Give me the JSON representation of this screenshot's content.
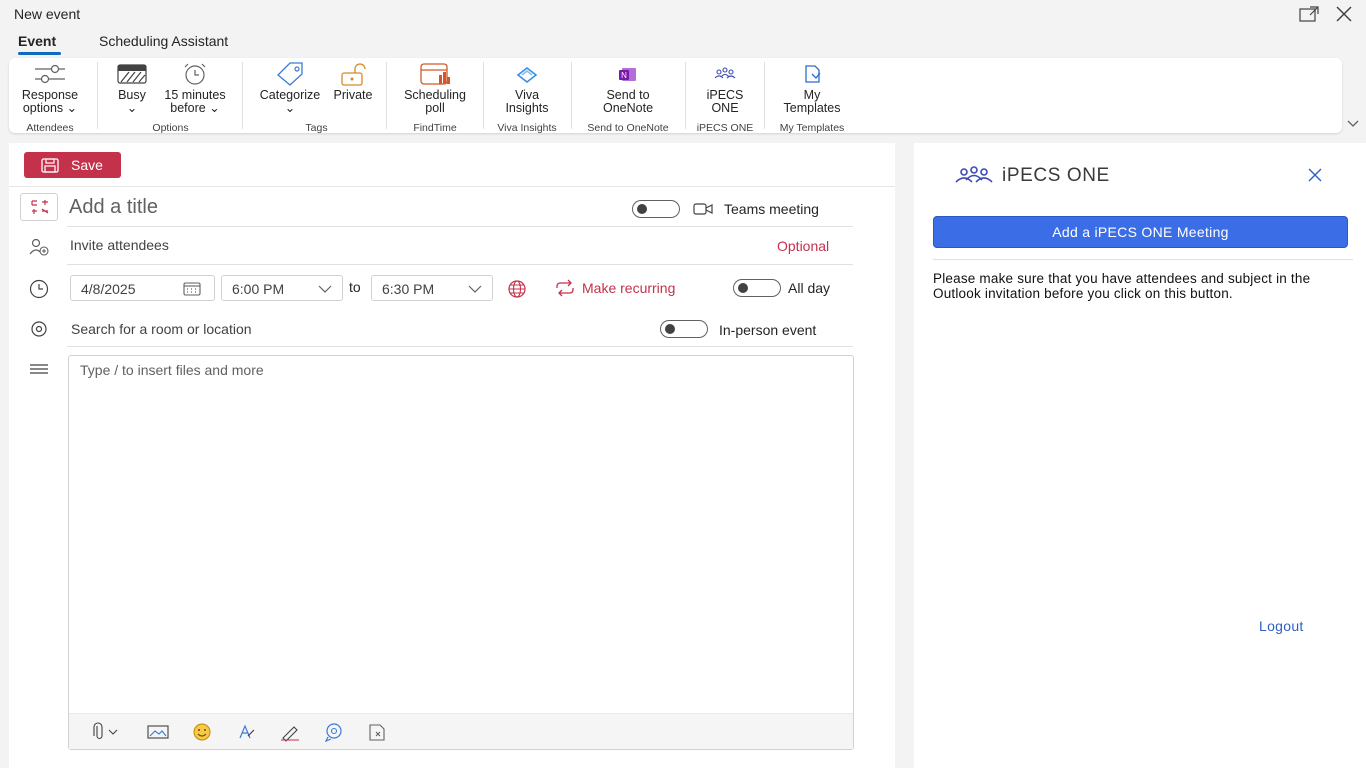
{
  "window": {
    "title": "New event"
  },
  "tabs": [
    {
      "label": "Event"
    },
    {
      "label": "Scheduling Assistant"
    }
  ],
  "ribbon": {
    "groups": [
      {
        "label": "Attendees",
        "buttons": [
          {
            "line1": "Response",
            "line2": "options"
          }
        ]
      },
      {
        "label": "Options",
        "buttons": [
          {
            "line1": "Busy"
          },
          {
            "line1": "15 minutes",
            "line2": "before"
          }
        ]
      },
      {
        "label": "Tags",
        "buttons": [
          {
            "line1": "Categorize"
          },
          {
            "line1": "Private"
          }
        ]
      },
      {
        "label": "FindTime",
        "buttons": [
          {
            "line1": "Scheduling",
            "line2": "poll"
          }
        ]
      },
      {
        "label": "Viva Insights",
        "buttons": [
          {
            "line1": "Viva",
            "line2": "Insights"
          }
        ]
      },
      {
        "label": "Send to OneNote",
        "buttons": [
          {
            "line1": "Send to",
            "line2": "OneNote"
          }
        ]
      },
      {
        "label": "iPECS ONE",
        "buttons": [
          {
            "line1": "iPECS",
            "line2": "ONE"
          }
        ]
      },
      {
        "label": "My Templates",
        "buttons": [
          {
            "line1": "My",
            "line2": "Templates"
          }
        ]
      }
    ]
  },
  "compose": {
    "save_label": "Save",
    "title_placeholder": "Add a title",
    "teams_label": "Teams meeting",
    "attendees_placeholder": "Invite attendees",
    "optional_label": "Optional",
    "start_date": "4/8/2025",
    "start_time": "6:00 PM",
    "to_label": "to",
    "end_time": "6:30 PM",
    "recurring_label": "Make recurring",
    "all_day_label": "All day",
    "location_placeholder": "Search for a room or location",
    "in_person_label": "In-person event",
    "body_placeholder": "Type / to insert files and more"
  },
  "addin": {
    "title": "iPECS ONE",
    "button_label": "Add a iPECS ONE Meeting",
    "message": "Please make sure that you have attendees and subject in the Outlook invitation before you click on this button.",
    "logout_label": "Logout"
  },
  "colors": {
    "save_red": "#c4314b",
    "accent_blue": "#0f6cbd",
    "addin_button_blue": "#3b6ee6",
    "link_red": "#c4314b"
  }
}
